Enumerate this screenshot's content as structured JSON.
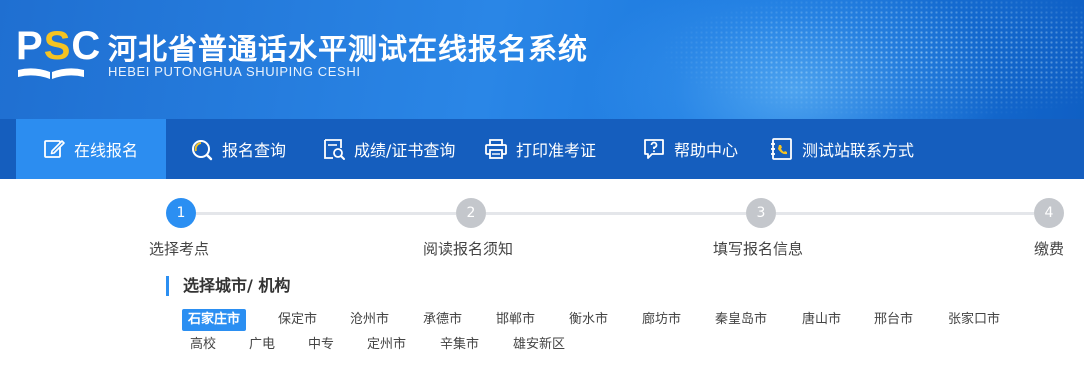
{
  "header": {
    "logo_text_left": "P",
    "logo_text_mid": "S",
    "logo_text_right": "C",
    "title": "河北省普通话水平测试在线报名系统",
    "subtitle": "HEBEI PUTONGHUA SHUIPING CESHI",
    "accent_color": "#f5c321"
  },
  "nav": {
    "items": [
      {
        "label": "在线报名",
        "icon": "edit-icon",
        "active": true
      },
      {
        "label": "报名查询",
        "icon": "search-icon",
        "active": false
      },
      {
        "label": "成绩/证书查询",
        "icon": "certificate-search-icon",
        "active": false
      },
      {
        "label": "打印准考证",
        "icon": "printer-icon",
        "active": false
      },
      {
        "label": "帮助中心",
        "icon": "help-icon",
        "active": false
      },
      {
        "label": "测试站联系方式",
        "icon": "phone-icon",
        "active": false
      }
    ]
  },
  "steps": [
    {
      "number": "1",
      "label": "选择考点",
      "active": true
    },
    {
      "number": "2",
      "label": "阅读报名须知",
      "active": false
    },
    {
      "number": "3",
      "label": "填写报名信息",
      "active": false
    },
    {
      "number": "4",
      "label": "缴费",
      "active": false
    }
  ],
  "city_section": {
    "title": "选择城市/ 机构",
    "selected": "石家庄市",
    "row1": [
      "石家庄市",
      "保定市",
      "沧州市",
      "承德市",
      "邯郸市",
      "衡水市",
      "廊坊市",
      "秦皇岛市",
      "唐山市",
      "邢台市",
      "张家口市"
    ],
    "row2": [
      "高校",
      "广电",
      "中专",
      "定州市",
      "辛集市",
      "雄安新区"
    ]
  },
  "colors": {
    "nav_bg": "#155ebe",
    "nav_active_bg": "#2c8df0",
    "step_active": "#2b8ff2",
    "step_inactive": "#c4c7cc"
  }
}
